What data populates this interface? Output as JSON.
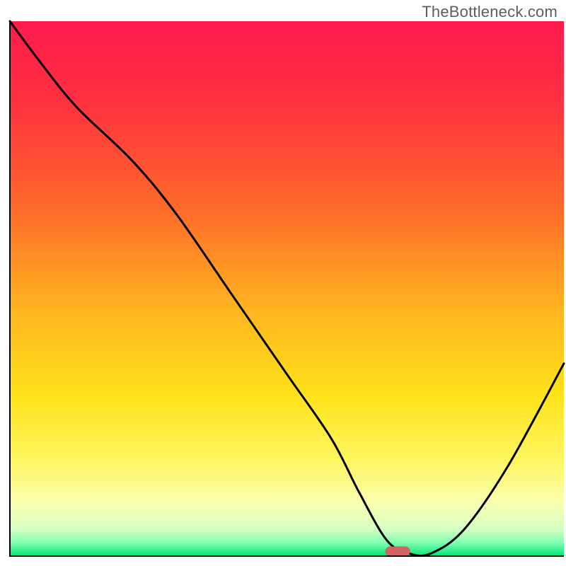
{
  "watermark": "TheBottleneck.com",
  "chart_data": {
    "type": "line",
    "title": "",
    "xlabel": "",
    "ylabel": "",
    "xlim": [
      0,
      100
    ],
    "ylim": [
      0,
      100
    ],
    "gradient_stops": [
      {
        "offset": 0,
        "color": "#ff1a4d"
      },
      {
        "offset": 0.15,
        "color": "#ff3040"
      },
      {
        "offset": 0.35,
        "color": "#ff6a2a"
      },
      {
        "offset": 0.55,
        "color": "#ffb81f"
      },
      {
        "offset": 0.7,
        "color": "#ffe21a"
      },
      {
        "offset": 0.82,
        "color": "#fff760"
      },
      {
        "offset": 0.9,
        "color": "#faffb0"
      },
      {
        "offset": 0.95,
        "color": "#d6ffc4"
      },
      {
        "offset": 0.975,
        "color": "#7fffb0"
      },
      {
        "offset": 1.0,
        "color": "#00e676"
      }
    ],
    "series": [
      {
        "name": "bottleneck-curve",
        "x": [
          0.0,
          5.0,
          12.0,
          22.0,
          30.0,
          40.0,
          50.0,
          58.0,
          63.0,
          68.0,
          72.0,
          76.0,
          82.0,
          90.0,
          100.0
        ],
        "y": [
          100.0,
          93.0,
          84.0,
          74.0,
          64.0,
          49.0,
          34.0,
          22.0,
          12.0,
          3.0,
          0.5,
          0.5,
          5.0,
          17.0,
          36.0
        ]
      }
    ],
    "marker": {
      "name": "sweet-spot",
      "x": 70.0,
      "y": 0.0,
      "color": "#d66363",
      "width": 4.5,
      "height": 1.8
    },
    "axes": {
      "border_color": "#000000",
      "border_width": 2
    }
  }
}
